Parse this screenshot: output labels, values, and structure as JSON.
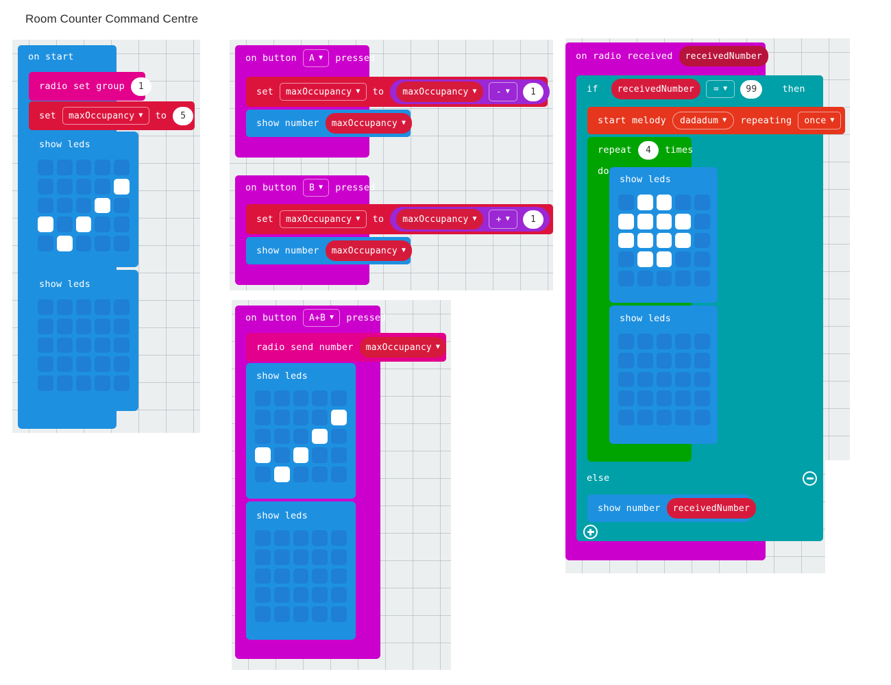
{
  "page": {
    "title": "Room Counter Command Centre",
    "background": "#ffffff",
    "workspace_background": "#ECEFF0"
  },
  "palette": {
    "event_magenta": "#CC00CC",
    "radio_pink": "#E3008C",
    "variables_red": "#DC143C",
    "basic_blue": "#1E90E0",
    "logic_teal": "#00A0A8",
    "loops_green": "#00A400",
    "music_orange": "#E6361D",
    "math_purple": "#9C27D4",
    "led_off": "#1E7FD4",
    "led_on": "#FFFFFF"
  },
  "scripts": [
    {
      "id": "on-start",
      "header": {
        "label": "on start",
        "color": "basic_blue"
      },
      "statements": [
        {
          "kind": "radio-set-group",
          "label": "radio set group",
          "value": "1",
          "color": "radio_pink"
        },
        {
          "kind": "set-variable",
          "label_set": "set",
          "variable": "maxOccupancy",
          "label_to": "to",
          "value": "5",
          "color": "variables_red"
        },
        {
          "kind": "show-leds",
          "label": "show leds",
          "color": "basic_blue",
          "pattern": [
            [
              0,
              0,
              0,
              0,
              0
            ],
            [
              0,
              0,
              0,
              0,
              1
            ],
            [
              0,
              0,
              0,
              1,
              0
            ],
            [
              1,
              0,
              1,
              0,
              0
            ],
            [
              0,
              1,
              0,
              0,
              0
            ]
          ]
        },
        {
          "kind": "show-leds",
          "label": "show leds",
          "color": "basic_blue",
          "pattern": [
            [
              0,
              0,
              0,
              0,
              0
            ],
            [
              0,
              0,
              0,
              0,
              0
            ],
            [
              0,
              0,
              0,
              0,
              0
            ],
            [
              0,
              0,
              0,
              0,
              0
            ],
            [
              0,
              0,
              0,
              0,
              0
            ]
          ]
        }
      ]
    },
    {
      "id": "on-button-a",
      "header": {
        "label_prefix": "on button",
        "button": "A",
        "label_suffix": "pressed",
        "color": "event_magenta"
      },
      "statements": [
        {
          "kind": "set-variable-expr",
          "label_set": "set",
          "variable": "maxOccupancy",
          "label_to": "to",
          "operand_variable": "maxOccupancy",
          "operator": "-",
          "operand_value": "1",
          "color": "variables_red",
          "expr_color": "math_purple"
        },
        {
          "kind": "show-number",
          "label": "show number",
          "variable": "maxOccupancy",
          "color": "basic_blue"
        }
      ]
    },
    {
      "id": "on-button-b",
      "header": {
        "label_prefix": "on button",
        "button": "B",
        "label_suffix": "pressed",
        "color": "event_magenta"
      },
      "statements": [
        {
          "kind": "set-variable-expr",
          "label_set": "set",
          "variable": "maxOccupancy",
          "label_to": "to",
          "operand_variable": "maxOccupancy",
          "operator": "+",
          "operand_value": "1",
          "color": "variables_red",
          "expr_color": "math_purple"
        },
        {
          "kind": "show-number",
          "label": "show number",
          "variable": "maxOccupancy",
          "color": "basic_blue"
        }
      ]
    },
    {
      "id": "on-button-ab",
      "header": {
        "label_prefix": "on button",
        "button": "A+B",
        "label_suffix": "pressed",
        "color": "event_magenta"
      },
      "statements": [
        {
          "kind": "radio-send-number",
          "label": "radio send number",
          "variable": "maxOccupancy",
          "color": "radio_pink"
        },
        {
          "kind": "show-leds",
          "label": "show leds",
          "color": "basic_blue",
          "pattern": [
            [
              0,
              0,
              0,
              0,
              0
            ],
            [
              0,
              0,
              0,
              0,
              1
            ],
            [
              0,
              0,
              0,
              1,
              0
            ],
            [
              1,
              0,
              1,
              0,
              0
            ],
            [
              0,
              1,
              0,
              0,
              0
            ]
          ]
        },
        {
          "kind": "show-leds",
          "label": "show leds",
          "color": "basic_blue",
          "pattern": [
            [
              0,
              0,
              0,
              0,
              0
            ],
            [
              0,
              0,
              0,
              0,
              0
            ],
            [
              0,
              0,
              0,
              0,
              0
            ],
            [
              0,
              0,
              0,
              0,
              0
            ],
            [
              0,
              0,
              0,
              0,
              0
            ]
          ]
        }
      ]
    },
    {
      "id": "on-radio-received",
      "header": {
        "label": "on radio received",
        "parameter": "receivedNumber",
        "color": "event_magenta"
      },
      "statements": [
        {
          "kind": "if-else",
          "label_if": "if",
          "label_then": "then",
          "label_else": "else",
          "color": "logic_teal",
          "condition": {
            "left_variable": "receivedNumber",
            "operator": "=",
            "right_value": "99"
          },
          "then_branch": [
            {
              "kind": "start-melody",
              "label_start": "start melody",
              "melody": "dadadum",
              "label_repeating": "repeating",
              "repeat_mode": "once",
              "color": "music_orange"
            },
            {
              "kind": "repeat",
              "label_repeat": "repeat",
              "times": "4",
              "label_times": "times",
              "label_do": "do",
              "color": "loops_green",
              "body": [
                {
                  "kind": "show-leds",
                  "label": "show leds",
                  "color": "basic_blue",
                  "pattern": [
                    [
                      0,
                      1,
                      1,
                      0,
                      0
                    ],
                    [
                      1,
                      1,
                      1,
                      1,
                      0
                    ],
                    [
                      1,
                      1,
                      1,
                      1,
                      0
                    ],
                    [
                      0,
                      1,
                      1,
                      0,
                      0
                    ],
                    [
                      0,
                      0,
                      0,
                      0,
                      0
                    ]
                  ]
                },
                {
                  "kind": "show-leds",
                  "label": "show leds",
                  "color": "basic_blue",
                  "pattern": [
                    [
                      0,
                      0,
                      0,
                      0,
                      0
                    ],
                    [
                      0,
                      0,
                      0,
                      0,
                      0
                    ],
                    [
                      0,
                      0,
                      0,
                      0,
                      0
                    ],
                    [
                      0,
                      0,
                      0,
                      0,
                      0
                    ],
                    [
                      0,
                      0,
                      0,
                      0,
                      0
                    ]
                  ]
                }
              ]
            }
          ],
          "else_branch": [
            {
              "kind": "show-number",
              "label": "show number",
              "variable": "receivedNumber",
              "color": "basic_blue"
            }
          ],
          "minus_button": "remove-branch",
          "plus_button": "add-branch"
        }
      ]
    }
  ]
}
